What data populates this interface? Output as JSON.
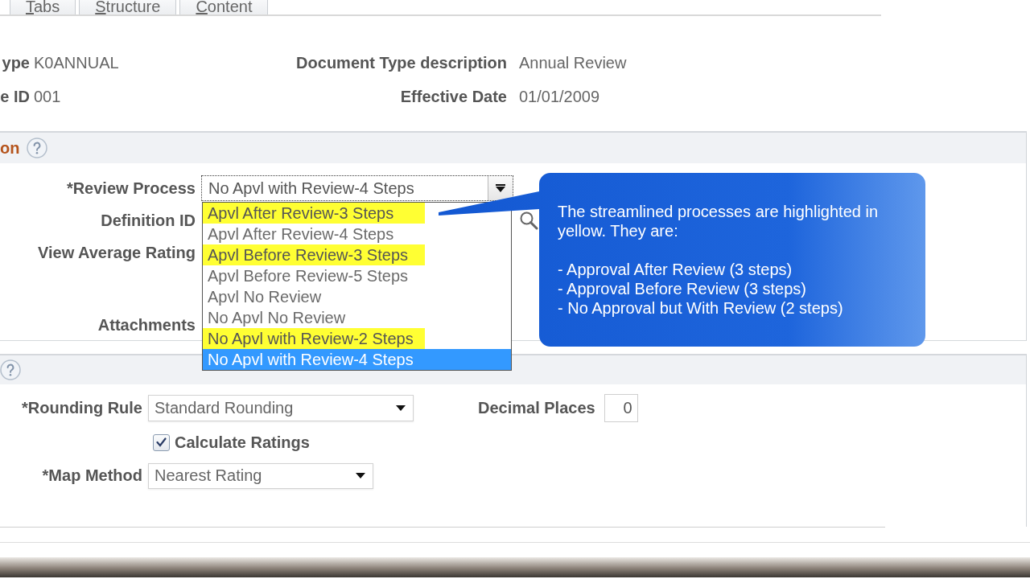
{
  "tabs": [
    {
      "label": "Tabs",
      "selected": false
    },
    {
      "label": "Structure",
      "selected": false
    },
    {
      "label": "Content",
      "selected": false
    }
  ],
  "header_fields": [
    {
      "label": "ype",
      "value": "K0ANNUAL"
    },
    {
      "label": "Document Type description",
      "value": "Annual Review"
    },
    {
      "label": "e ID",
      "value": "001"
    },
    {
      "label": "Effective Date",
      "value": "01/01/2009"
    }
  ],
  "section_1": {
    "title": "on",
    "fields": [
      {
        "kind": "select",
        "label": "*Review Process",
        "value": "No Apvl with Review-4 Steps",
        "expanded": true,
        "options": [
          {
            "label": "Apvl After Review-3 Steps",
            "highlighted": true,
            "selected": false
          },
          {
            "label": "Apvl After Review-4 Steps",
            "highlighted": false,
            "selected": false
          },
          {
            "label": "Apvl Before Review-3 Steps",
            "highlighted": true,
            "selected": false
          },
          {
            "label": "Apvl Before Review-5 Steps",
            "highlighted": false,
            "selected": false
          },
          {
            "label": "Apvl No Review",
            "highlighted": false,
            "selected": false
          },
          {
            "label": "No Apvl No Review",
            "highlighted": false,
            "selected": false
          },
          {
            "label": "No Apvl with Review-2 Steps",
            "highlighted": true,
            "selected": false
          },
          {
            "label": "No Apvl with Review-4 Steps",
            "highlighted": false,
            "selected": true
          }
        ]
      },
      {
        "kind": "lookup",
        "label": "Definition ID"
      },
      {
        "kind": "label",
        "label": "View Average Rating"
      },
      {
        "kind": "label",
        "label": "Attachments"
      }
    ]
  },
  "callout": {
    "text": "The streamlined processes are highlighted in yellow. They are:",
    "items": [
      "- Approval After Review (3 steps)",
      "- Approval Before Review (3 steps)",
      "- No Approval but With Review (2 steps)"
    ]
  },
  "section_2": {
    "rows": [
      {
        "fields": [
          {
            "kind": "select",
            "label": "*Rounding Rule",
            "value": "Standard Rounding",
            "expanded": false
          },
          {
            "kind": "number",
            "label": "Decimal Places",
            "value": "0"
          }
        ]
      },
      {
        "fields": [
          {
            "kind": "checkbox",
            "label": "Calculate Ratings",
            "checked": true
          }
        ]
      },
      {
        "fields": [
          {
            "kind": "select",
            "label": "*Map Method",
            "value": "Nearest Rating",
            "expanded": false
          }
        ]
      }
    ]
  }
}
